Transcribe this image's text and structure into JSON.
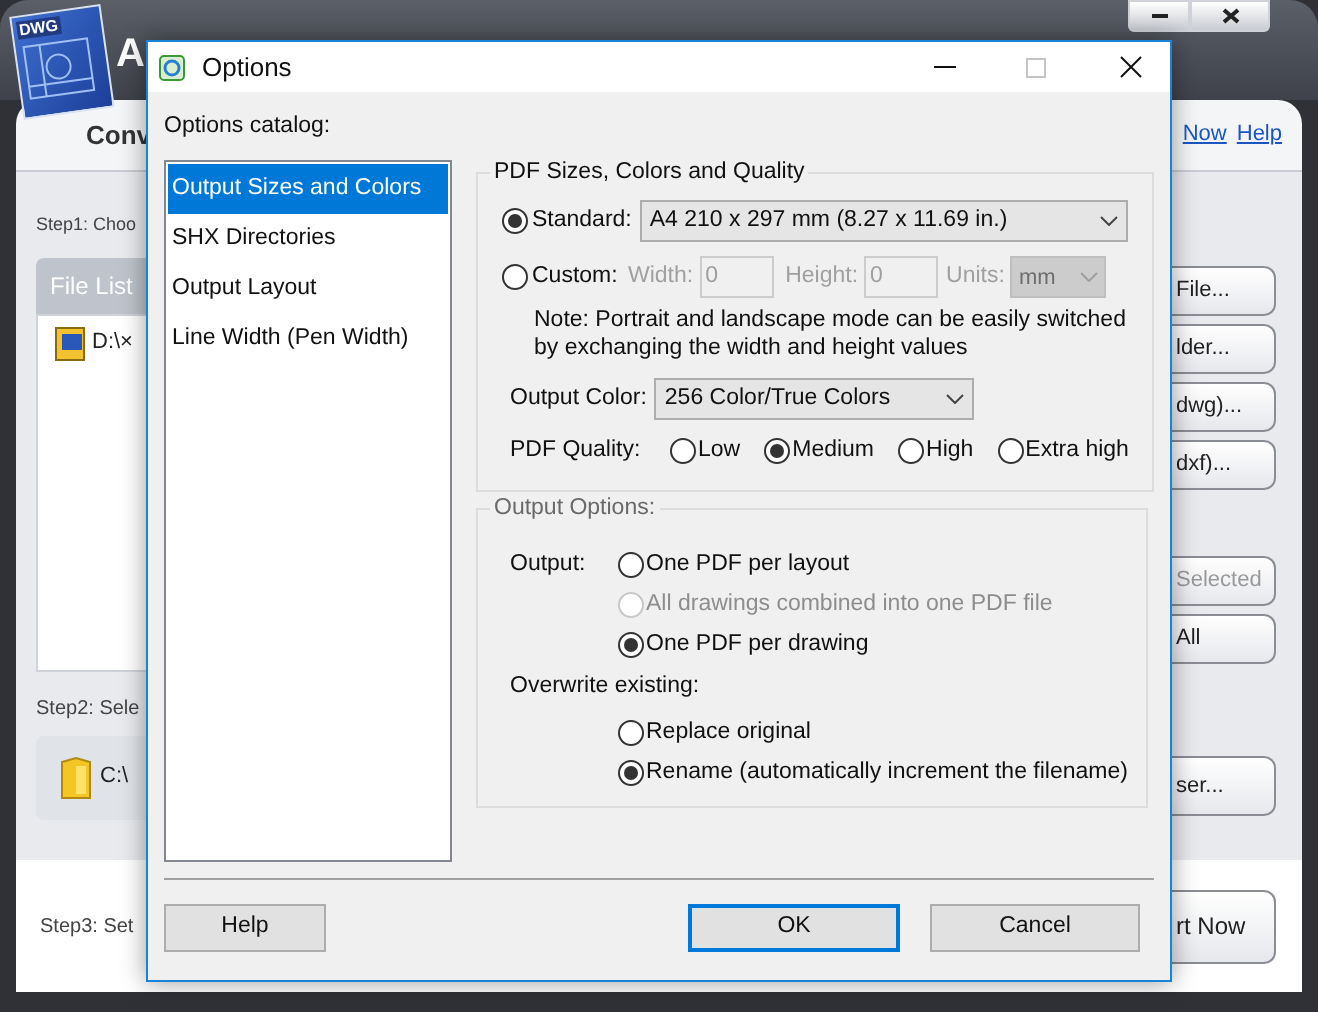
{
  "app": {
    "logo_text": "DWG",
    "title": "A",
    "heading": "Conv",
    "links": [
      "Now",
      "Help"
    ],
    "step1_label": "Step1: Choo",
    "file_list": {
      "header": "File List",
      "items": [
        "D:\\×"
      ]
    },
    "step2_label": "Step2: Sele",
    "folder_path": "C:\\",
    "step3_label": "Step3: Set",
    "button_groups": [
      [
        {
          "label": "File...",
          "disabled": false
        },
        {
          "label": "lder...",
          "disabled": false
        },
        {
          "label": "dwg)...",
          "disabled": false
        },
        {
          "label": "dxf)...",
          "disabled": false
        }
      ],
      [
        {
          "label": "Selected",
          "disabled": true
        },
        {
          "label": "All",
          "disabled": false
        }
      ],
      [
        {
          "label": "ser...",
          "disabled": false
        }
      ]
    ],
    "start_button": "rt Now"
  },
  "dialog": {
    "title": "Options",
    "catalog_label": "Options catalog:",
    "catalog": [
      {
        "label": "Output Sizes and Colors",
        "selected": true
      },
      {
        "label": "SHX Directories",
        "selected": false
      },
      {
        "label": "Output Layout",
        "selected": false
      },
      {
        "label": "Line Width (Pen Width)",
        "selected": false
      }
    ],
    "size_group": {
      "title": "PDF Sizes, Colors and Quality",
      "standard": {
        "label": "Standard:",
        "selected": true,
        "value": "A4 210 x 297 mm (8.27 x 11.69 in.)"
      },
      "custom": {
        "label": "Custom:",
        "selected": false,
        "enabled": false,
        "width_label": "Width:",
        "width_value": "0",
        "height_label": "Height:",
        "height_value": "0",
        "units_label": "Units:",
        "units_value": "mm"
      },
      "note": "Note: Portrait and landscape mode can be easily switched by exchanging the width and height values",
      "output_color": {
        "label": "Output Color:",
        "value": "256 Color/True Colors"
      },
      "quality": {
        "label": "PDF Quality:",
        "options": [
          {
            "label": "Low",
            "selected": false
          },
          {
            "label": "Medium",
            "selected": true
          },
          {
            "label": "High",
            "selected": false
          },
          {
            "label": "Extra high",
            "selected": false
          }
        ]
      }
    },
    "output_group": {
      "title": "Output Options:",
      "output_label": "Output:",
      "output_options": [
        {
          "label": "One PDF per layout",
          "selected": false,
          "disabled": false
        },
        {
          "label": "All drawings combined into one PDF file",
          "selected": false,
          "disabled": true
        },
        {
          "label": "One PDF per drawing",
          "selected": true,
          "disabled": false
        }
      ],
      "overwrite_label": "Overwrite existing:",
      "overwrite_options": [
        {
          "label": "Replace original",
          "selected": false,
          "disabled": false
        },
        {
          "label": "Rename (automatically increment the filename)",
          "selected": true,
          "disabled": false
        }
      ]
    },
    "buttons": [
      {
        "label": "Help",
        "focused": false
      },
      {
        "label": "OK",
        "focused": true
      },
      {
        "label": "Cancel",
        "focused": false
      }
    ]
  }
}
